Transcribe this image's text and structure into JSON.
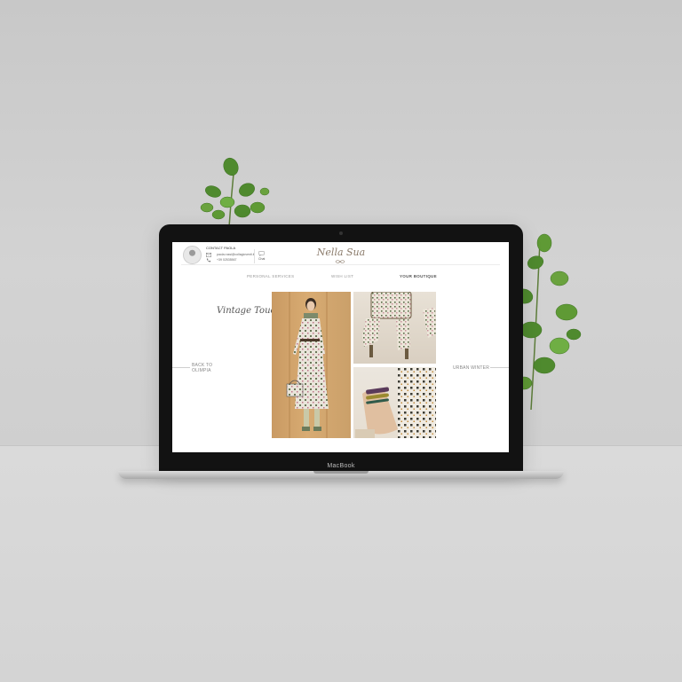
{
  "device": {
    "brand_label": "MacBook"
  },
  "site": {
    "brand": "Nella Sua",
    "contact": {
      "name": "CONTACT PAOLA",
      "email": "paola.rossi@collagioventi.it",
      "phone": "+39 02535567",
      "chat_label": "Chat"
    },
    "nav": [
      {
        "label": "PERSONAL SERVICES",
        "active": false
      },
      {
        "label": "WISH LIST",
        "active": false
      },
      {
        "label": "YOUR BOUTIQUE",
        "active": true
      }
    ],
    "collection_title": "Vintage Touch",
    "back_link": {
      "line1": "BACK TO",
      "line2": "OLIMPIA"
    },
    "next_link": "URBAN WINTER"
  },
  "icons": [
    "avatar",
    "mail-icon",
    "phone-icon",
    "chat-icon",
    "brand-mark-icon"
  ],
  "colors": {
    "lid": "#121212",
    "screen": "#ffffff",
    "brand": "#8a7a6a",
    "leaf": "#4f8a2e"
  }
}
